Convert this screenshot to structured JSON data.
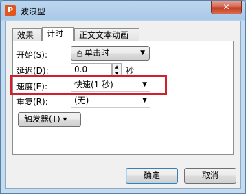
{
  "window": {
    "title": "波浪型",
    "close_label": "✕",
    "icon_letter": "P"
  },
  "tabs": [
    {
      "label": "效果",
      "active": false
    },
    {
      "label": "计时",
      "active": true
    },
    {
      "label": "正文文本动画",
      "active": false
    }
  ],
  "form": {
    "start": {
      "label": "开始(S):",
      "value": "单击时",
      "icon": "mouse-click-icon"
    },
    "delay": {
      "label": "延迟(D):",
      "value": "0.0",
      "unit": "秒"
    },
    "speed": {
      "label": "速度(E):",
      "value": "快速(1 秒)"
    },
    "repeat": {
      "label": "重复(R):",
      "value": "(无)"
    },
    "trigger_label": "触发器(T) ▾"
  },
  "buttons": {
    "ok": "确定",
    "cancel": "取消"
  },
  "colors": {
    "highlight": "#d2202a",
    "title_bar": "#a9c9e8"
  }
}
